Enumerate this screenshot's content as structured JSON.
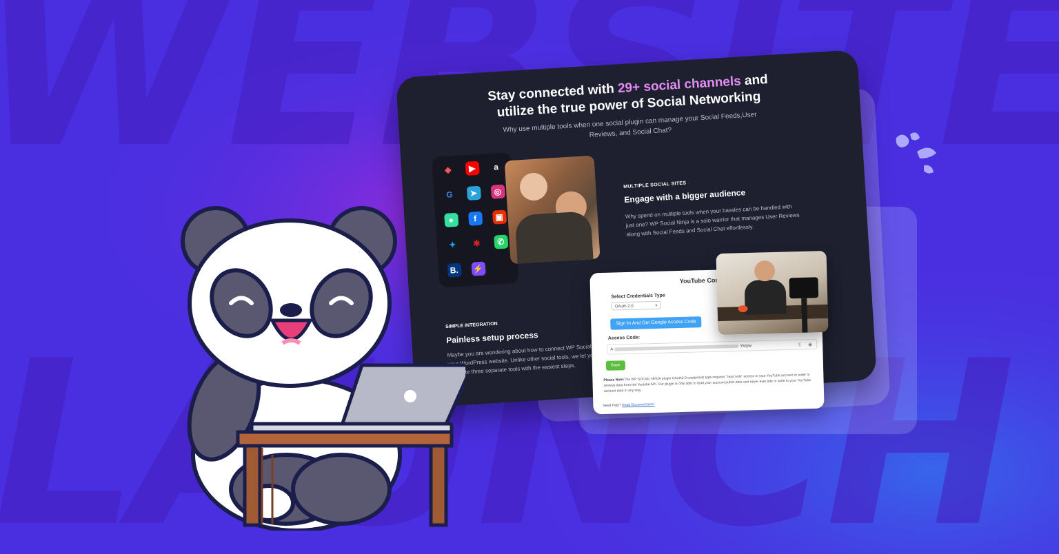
{
  "background": {
    "color": "#4a2fe0",
    "watermark_row1": "WEBSITE",
    "watermark_row2": "LAUNCH"
  },
  "hero": {
    "title_pre": "Stay connected with ",
    "title_accent": "29+ social channels",
    "title_post": " and",
    "title_line2": "utilize the true power of Social Networking",
    "subtitle": "Why use multiple tools when one social plugin can manage your Social Feeds,User Reviews, and Social Chat?",
    "accent_color": "#e48cf2"
  },
  "social_icons": [
    {
      "name": "airbnb-icon",
      "glyph": "◈",
      "color": "#ff5a5f",
      "bg": "transparent"
    },
    {
      "name": "youtube-icon",
      "glyph": "▶",
      "color": "#ffffff",
      "bg": "#ff0000"
    },
    {
      "name": "amazon-icon",
      "glyph": "a",
      "color": "#ffffff",
      "bg": "transparent"
    },
    {
      "name": "google-icon",
      "glyph": "G",
      "color": "#4285f4",
      "bg": "transparent"
    },
    {
      "name": "telegram-icon",
      "glyph": "➤",
      "color": "#ffffff",
      "bg": "#2aa3dd"
    },
    {
      "name": "instagram-icon",
      "glyph": "◎",
      "color": "#ffffff",
      "bg": "#d9337b"
    },
    {
      "name": "tripadvisor-icon",
      "glyph": "●",
      "color": "#ffffff",
      "bg": "#34e0a1"
    },
    {
      "name": "facebook-icon",
      "glyph": "f",
      "color": "#ffffff",
      "bg": "#1877f2"
    },
    {
      "name": "aliexpress-icon",
      "glyph": "▣",
      "color": "#ffffff",
      "bg": "#e62e04"
    },
    {
      "name": "twitter-icon",
      "glyph": "✦",
      "color": "#1da1f2",
      "bg": "transparent"
    },
    {
      "name": "yelp-icon",
      "glyph": "✱",
      "color": "#d32323",
      "bg": "transparent"
    },
    {
      "name": "whatsapp-icon",
      "glyph": "✆",
      "color": "#ffffff",
      "bg": "#25d366"
    },
    {
      "name": "booking-icon",
      "glyph": "B.",
      "color": "#ffffff",
      "bg": "#003580"
    },
    {
      "name": "messenger-icon",
      "glyph": "⚡",
      "color": "#ffffff",
      "bg": "#7b4dff"
    }
  ],
  "multiple_sites": {
    "eyebrow": "MULTIPLE SOCIAL SITES",
    "title": "Engage with a bigger audience",
    "body": "Why spend on multiple tools when your hassles can be handled with just one? WP Social Ninja is a solo warrior that manages User Reviews along with Social Feeds and Social Chat effortlessly."
  },
  "simple_integration": {
    "eyebrow": "SIMPLE INTEGRATION",
    "title": "Painless setup process",
    "body": "Maybe you are wondering about how to connect WP Social Ninja to your WordPress website. Unlike other social tools, we let you integrate three separate tools with the easiest steps."
  },
  "settings_card": {
    "title": "YouTube Con",
    "credentials_label": "Select Credentials Type",
    "credentials_value": "OAuth 2.0",
    "google_button": "Sign In And Get Google Access Code",
    "access_label": "Access Code:",
    "access_prefix": "A",
    "access_suffix": "Ykrpw",
    "save_button": "Save",
    "note_label": "Please Note:",
    "note_text": "The WP SOCIAL NINJA plugin OAuth2.0 credentials type requires \"read only\" access to your YouTube account in order to retrieve data from the Youtube API. Our plugin is only able to read your account public data and never ever edit or write to your YouTube account data in any way.",
    "help_prefix": "Need Help?",
    "help_link": "Read Documentation"
  }
}
